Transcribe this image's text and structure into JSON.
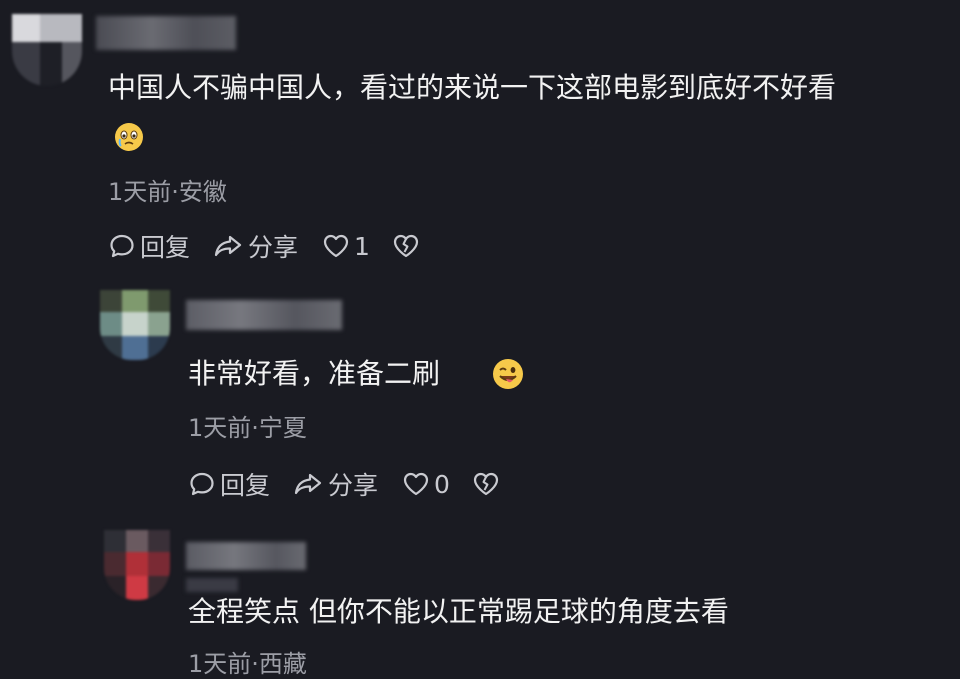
{
  "comments": [
    {
      "text_line1": "中国人不骗中国人，看过的来说一下这部电影到底好不好看",
      "emoji": "crying-face-emoji",
      "meta": "1天前·安徽",
      "reply_label": "回复",
      "share_label": "分享",
      "like_count": "1"
    },
    {
      "text": "非常好看，准备二刷",
      "emoji": "winking-tongue-face-emoji",
      "meta": "1天前·宁夏",
      "reply_label": "回复",
      "share_label": "分享",
      "like_count": "0"
    },
    {
      "text": "全程笑点 但你不能以正常踢足球的角度去看",
      "meta": "1天前·西藏"
    }
  ],
  "colors": {
    "background": "#1a1b22",
    "text": "#f2f2f2",
    "meta": "#9c9ea6",
    "action": "#c9cad0"
  }
}
